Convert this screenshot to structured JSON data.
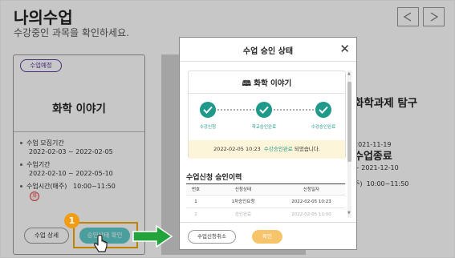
{
  "page": {
    "title": "나의수업",
    "subtitle": "수강중인 과목을 확인하세요.",
    "nav": {
      "prev_icon": "chevron-left-icon",
      "next_icon": "chevron-right-icon"
    }
  },
  "left_card": {
    "badge": "수업예정",
    "title": "화학 이야기",
    "recruit_label": "수업 모집기간",
    "recruit_value": "2022-02-03 ~ 2022-02-05",
    "period_label": "수업기간",
    "period_value": "2022-02-10 ~ 2022-05-10",
    "time_label": "수업시간(매주)",
    "time_value": "10:00~11:50",
    "day": "화",
    "detail_button": "수업 상세",
    "status_button": "승인상태 확인"
  },
  "right_card": {
    "title": "화학과제 탐구",
    "date_top": "2021-11-19",
    "status": "수업종료",
    "period_end": "~ 2021-12-10",
    "time_prefix": "주)",
    "time_value": "10:00~11:50"
  },
  "modal": {
    "title": "수업 승인 상태",
    "close_icon": "close-icon",
    "course_name": "화학 이야기",
    "course_icon": "book-icon",
    "steps": [
      "수강신청",
      "학교승인완료",
      "수강승인완료"
    ],
    "notice_date": "2022-02-05 10:23",
    "notice_highlight": "수강승인완료",
    "notice_suffix": "되었습니다.",
    "history_title": "수업신청 승인이력",
    "table": {
      "headers": [
        "번호",
        "신청상태",
        "신청일자"
      ],
      "rows": [
        [
          "1",
          "1차승인요청",
          "2022-02-05 10:23"
        ],
        [
          "2",
          "승인완료",
          "2022-02-05 11:00"
        ]
      ]
    },
    "cancel_button": "수업신청취소",
    "ok_button": "확인"
  },
  "annotation": {
    "step_number": "1",
    "accent_color": "#f29c13",
    "arrow_color": "#22a33c"
  }
}
